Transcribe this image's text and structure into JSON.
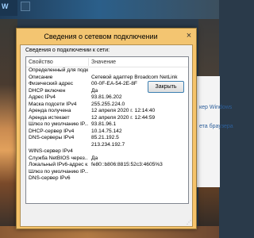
{
  "background": {
    "right_panel_lines": [
      "кер Windows",
      "ета браузера"
    ],
    "top_left_label": "W"
  },
  "dialog": {
    "title": "Сведения о сетевом подключении",
    "caption": "Сведения о подключении к сети:",
    "columns": {
      "property": "Свойство",
      "value": "Значение"
    },
    "rows": [
      {
        "property": "Определенный для подклю...",
        "value": ""
      },
      {
        "property": "Описание",
        "value": "Сетевой адаптер Broadcom NetLink"
      },
      {
        "property": "Физический адрес",
        "value": "00-0F-EA-54-2E-8F"
      },
      {
        "property": "DHCP включен",
        "value": "Да"
      },
      {
        "property": "Адрес IPv4",
        "value": "93.81.96.202"
      },
      {
        "property": "Маска подсети IPv4",
        "value": "255.255.224.0"
      },
      {
        "property": "Аренда получена",
        "value": "12 апреля 2020 г. 12:14:40"
      },
      {
        "property": "Аренда истекает",
        "value": "12 апреля 2020 г. 12:44:59"
      },
      {
        "property": "Шлюз по умолчанию IP...",
        "value": "93.81.96.1"
      },
      {
        "property": "DHCP-сервер IPv4",
        "value": "10.14.75.142"
      },
      {
        "property": "DNS-серверы IPv4",
        "value": "85.21.192.5"
      },
      {
        "property": "",
        "value": "213.234.192.7"
      },
      {
        "property": "WINS-сервер IPv4",
        "value": ""
      },
      {
        "property": "Служба NetBIOS через...",
        "value": "Да"
      },
      {
        "property": "Локальный IPv6-адрес к...",
        "value": "fe80::b806:8815:52c3:4605%3"
      },
      {
        "property": "Шлюз по умолчанию IP...",
        "value": ""
      },
      {
        "property": "DNS-сервер IPv6",
        "value": ""
      }
    ],
    "close_button_label": "Закрыть",
    "close_icon": "×"
  }
}
